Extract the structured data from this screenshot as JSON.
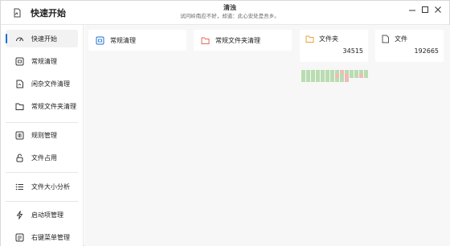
{
  "app": {
    "title": "快速开始"
  },
  "titlebar": {
    "main": "清浊",
    "sub": "试问岭南应不好，却道：此心安处是吾乡。"
  },
  "sidebar": {
    "items": [
      {
        "label": "快速开始",
        "icon": "speedometer-icon",
        "active": true
      },
      {
        "label": "常规清理",
        "icon": "broom-box-icon",
        "active": false
      },
      {
        "label": "闲杂文件清理",
        "icon": "file-icon",
        "active": false
      },
      {
        "label": "常规文件夹清理",
        "icon": "folder-icon",
        "active": false
      },
      {
        "label": "规则管理",
        "icon": "rules-icon",
        "active": false
      },
      {
        "label": "文件占用",
        "icon": "lock-icon",
        "active": false
      },
      {
        "label": "文件大小分析",
        "icon": "list-icon",
        "active": false
      },
      {
        "label": "启动项管理",
        "icon": "bolt-icon",
        "active": false
      },
      {
        "label": "右键菜单管理",
        "icon": "menu-box-icon",
        "active": false
      }
    ]
  },
  "main": {
    "cards": [
      {
        "label": "常规清理",
        "icon": "broom-box-icon"
      },
      {
        "label": "常规文件夹清理",
        "icon": "folder-icon"
      }
    ],
    "stats": [
      {
        "label": "文件夹",
        "value": "34515",
        "icon": "folder-icon"
      },
      {
        "label": "文件",
        "value": "192665",
        "icon": "file-icon"
      }
    ]
  },
  "colors": {
    "accent": "#1a6fd6",
    "cell_green": "#b9dcb0",
    "cell_red": "#f2b8b8",
    "folder": "#e8a33c",
    "folder_red": "#e46a5a"
  }
}
